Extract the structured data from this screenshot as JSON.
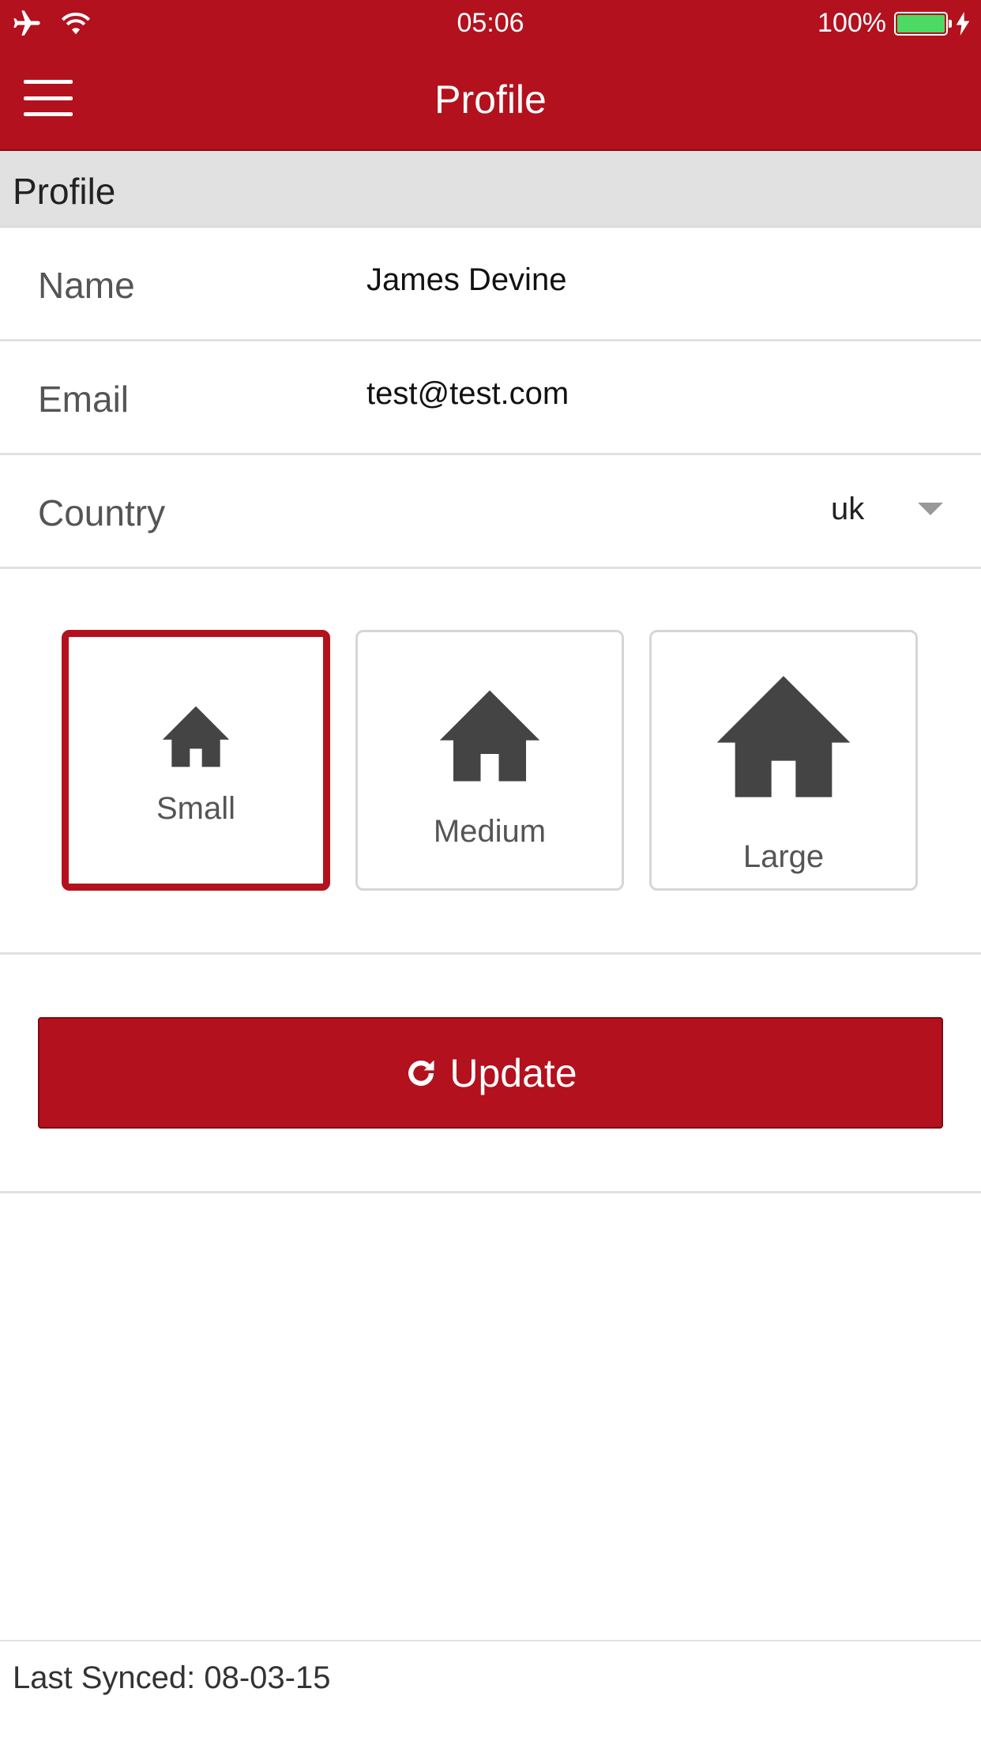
{
  "status_bar": {
    "time": "05:06",
    "battery_text": "100%",
    "battery_level": 1.0,
    "icons": [
      "airplane-icon",
      "wifi-icon",
      "battery-icon",
      "charging-icon"
    ]
  },
  "nav": {
    "title": "Profile",
    "menu_icon": "hamburger-menu-icon"
  },
  "section": {
    "title": "Profile"
  },
  "form": {
    "name_label": "Name",
    "name_value": "James Devine",
    "email_label": "Email",
    "email_value": "test@test.com",
    "country_label": "Country",
    "country_value": "uk"
  },
  "sizes": {
    "selected": "Small",
    "options": [
      {
        "label": "Small",
        "icon": "home-icon"
      },
      {
        "label": "Medium",
        "icon": "home-icon"
      },
      {
        "label": "Large",
        "icon": "home-icon"
      }
    ]
  },
  "update": {
    "label": "Update",
    "icon": "refresh-icon"
  },
  "footer": {
    "last_synced": "Last Synced: 08-03-15"
  },
  "colors": {
    "brand": "#b3111e",
    "section_bg": "#e1e1e1",
    "icon_gray": "#444444",
    "battery_green": "#4cd964"
  }
}
